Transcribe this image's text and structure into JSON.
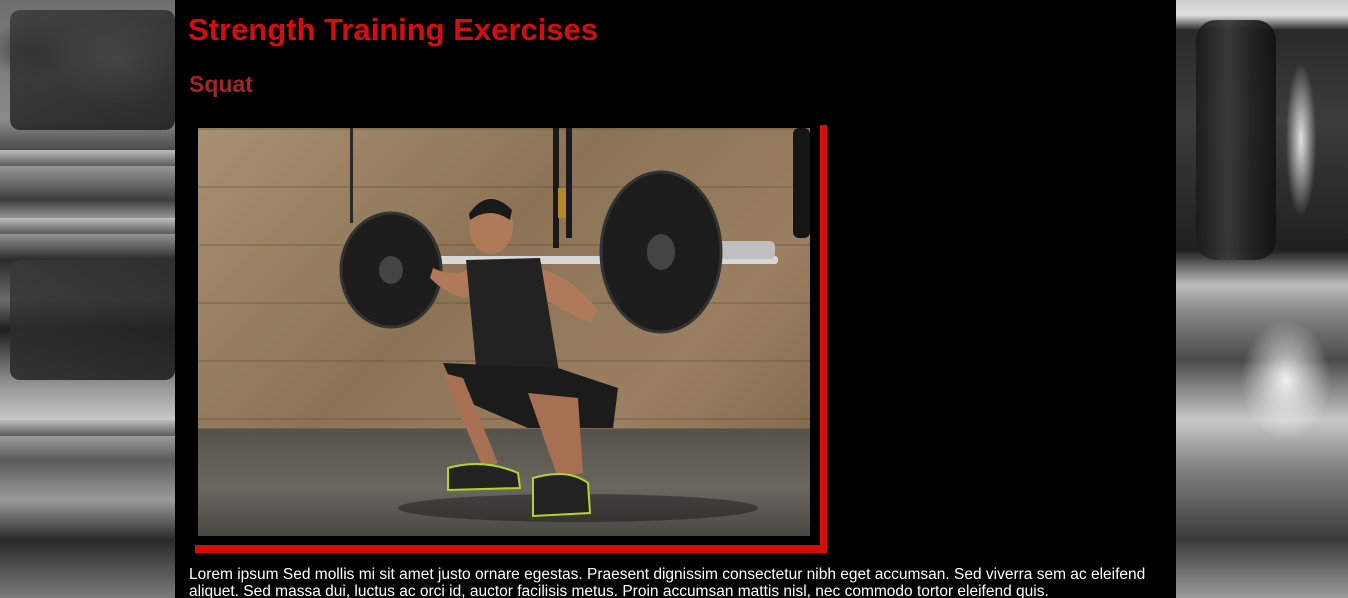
{
  "page": {
    "title": "Strength Training Exercises"
  },
  "section": {
    "title": "Squat",
    "image_alt": "Man performing a barbell back squat in a gym",
    "body": "Lorem ipsum Sed mollis mi sit amet justo ornare egestas. Praesent dignissim consectetur nibh eget accumsan. Sed viverra sem ac eleifend aliquet. Sed massa dui, luctus ac orci id, auctor facilisis metus. Proin accumsan mattis nisl, nec commodo tortor eleifend quis."
  },
  "colors": {
    "title": "#d50d0f",
    "subtitle": "#a0262a",
    "frame_accent": "#d50d0f",
    "background": "#000000",
    "text": "#ffffff"
  }
}
